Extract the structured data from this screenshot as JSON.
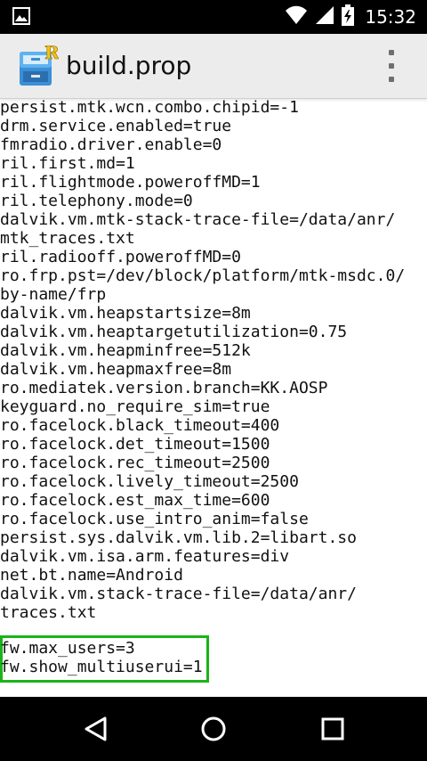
{
  "status_bar": {
    "time": "15:32",
    "icons": [
      "image-notification-icon",
      "wifi-icon",
      "cell-signal-icon",
      "battery-charging-icon"
    ]
  },
  "action_bar": {
    "title": "build.prop",
    "app_icon": "root-explorer-cabinet-icon",
    "overflow_icon": "overflow-menu-icon"
  },
  "content": {
    "lines": [
      "persist.mtk.wcn.combo.chipid=-1",
      "drm.service.enabled=true",
      "fmradio.driver.enable=0",
      "ril.first.md=1",
      "ril.flightmode.poweroffMD=1",
      "ril.telephony.mode=0",
      "dalvik.vm.mtk-stack-trace-file=/data/anr/",
      "mtk_traces.txt",
      "ril.radiooff.poweroffMD=0",
      "ro.frp.pst=/dev/block/platform/mtk-msdc.0/",
      "by-name/frp",
      "dalvik.vm.heapstartsize=8m",
      "dalvik.vm.heaptargetutilization=0.75",
      "dalvik.vm.heapminfree=512k",
      "dalvik.vm.heapmaxfree=8m",
      "ro.mediatek.version.branch=KK.AOSP",
      "keyguard.no_require_sim=true",
      "ro.facelock.black_timeout=400",
      "ro.facelock.det_timeout=1500",
      "ro.facelock.rec_timeout=2500",
      "ro.facelock.lively_timeout=2500",
      "ro.facelock.est_max_time=600",
      "ro.facelock.use_intro_anim=false",
      "persist.sys.dalvik.vm.lib.2=libart.so",
      "dalvik.vm.isa.arm.features=div",
      "net.bt.name=Android",
      "dalvik.vm.stack-trace-file=/data/anr/",
      "traces.txt"
    ],
    "highlighted_lines": [
      "fw.max_users=3",
      "fw.show_multiuserui=1"
    ],
    "highlight_color": "#19b419"
  },
  "nav_bar": {
    "back_icon": "back-triangle-icon",
    "home_icon": "home-circle-icon",
    "recents_icon": "recents-square-icon"
  }
}
